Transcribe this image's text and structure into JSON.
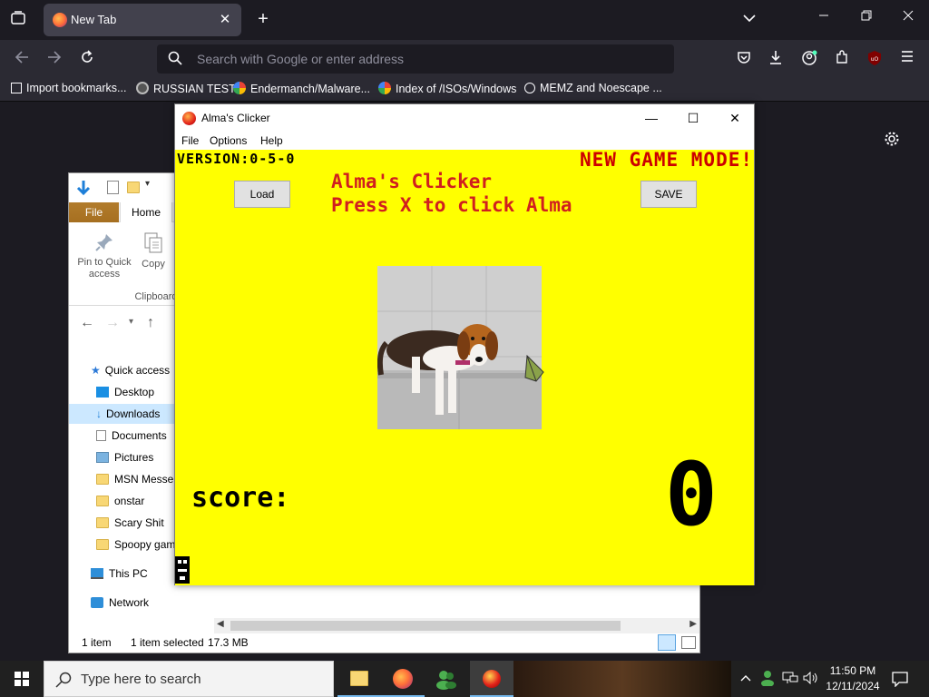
{
  "browser": {
    "tab_title": "New Tab",
    "search_placeholder": "Search with Google or enter address",
    "bookmarks": [
      {
        "label": "Import bookmarks..."
      },
      {
        "label": "RUSSIAN TEST"
      },
      {
        "label": "Endermanch/Malware..."
      },
      {
        "label": "Index of /ISOs/Windows"
      },
      {
        "label": "MEMZ and Noescape ..."
      }
    ]
  },
  "explorer": {
    "ribbon_tabs": {
      "file": "File",
      "home": "Home"
    },
    "ribbon_buttons": {
      "pin": "Pin to Quick access",
      "pin_line1": "Pin to Quick",
      "pin_line2": "access",
      "copy": "Copy",
      "group": "Clipboard"
    },
    "nav": [
      {
        "label": "Quick access"
      },
      {
        "label": "Desktop"
      },
      {
        "label": "Downloads"
      },
      {
        "label": "Documents"
      },
      {
        "label": "Pictures"
      },
      {
        "label": "MSN Messe"
      },
      {
        "label": "onstar"
      },
      {
        "label": "Scary Shit"
      },
      {
        "label": "Spoopy gam"
      },
      {
        "label": "This PC"
      },
      {
        "label": "Network"
      }
    ],
    "status": {
      "items": "1 item",
      "selected": "1 item selected",
      "size": "17.3 MB"
    }
  },
  "game": {
    "window_title": "Alma's Clicker",
    "menu": {
      "file": "File",
      "options": "Options",
      "help": "Help"
    },
    "version": "VERSION:0-5-0",
    "mode": "NEW GAME MODE!",
    "heading_line1": "Alma's Clicker",
    "heading_line2": "Press X to click Alma",
    "load_label": "Load",
    "save_label": "SAVE",
    "score_label": "score:",
    "score_value": "0"
  },
  "taskbar": {
    "search_placeholder": "Type here to search",
    "time": "11:50 PM",
    "date": "12/11/2024"
  }
}
